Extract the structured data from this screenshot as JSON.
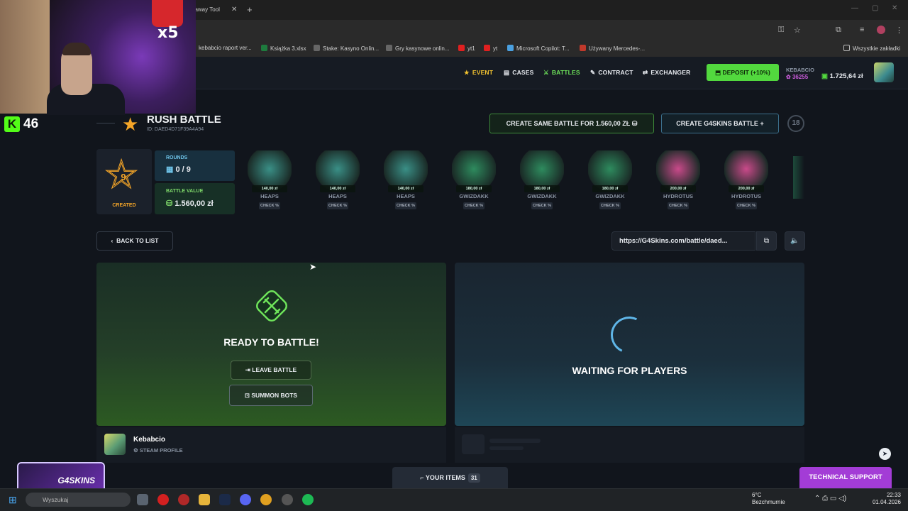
{
  "browser": {
    "tab_title": "eaway Tool",
    "bookmarks": [
      "kebabcio raport ver...",
      "Książka 3.xlsx",
      "Stake: Kasyno Onlin...",
      "Gry kasynowe onlin...",
      "yt1",
      "yt",
      "Microsoft Copilot: T...",
      "Używany Mercedes-..."
    ],
    "bookmarks_right": "Wszystkie zakładki"
  },
  "stream": {
    "kick_count": "46",
    "camera_sign": "x5"
  },
  "header": {
    "nav": [
      "EVENT",
      "CASES",
      "BATTLES",
      "CONTRACT",
      "EXCHANGER"
    ],
    "deposit_label": "DEPOSIT (+10%)",
    "username": "KEBABCIO",
    "coins": "36255",
    "balance": "1.725,64 zł"
  },
  "battle": {
    "title": "RUSH BATTLE",
    "id": "ID: DAED4D71F39A4A94",
    "create_same": "CREATE SAME BATTLE FOR 1.560,00 ZŁ",
    "create_new": "CREATE G4SKINS BATTLE",
    "age_badge": "18",
    "created_count": "9",
    "created_label": "CREATED",
    "rounds_label": "ROUNDS",
    "rounds_value": "0 / 9",
    "value_label": "BATTLE VALUE",
    "value_value": "1.560,00 zł",
    "back_label": "BACK TO LIST",
    "share_url": "https://G4Skins.com/battle/daed...",
    "ready_text": "READY TO BATTLE!",
    "leave_label": "LEAVE BATTLE",
    "summon_label": "SUMMON BOTS",
    "waiting_text": "WAITING FOR PLAYERS",
    "player_name": "Kebabcio",
    "player_link": "STEAM PROFILE"
  },
  "cases": [
    {
      "name": "HEAPS",
      "price": "140,00 zł",
      "check": "CHECK %",
      "color": "#3a8f86"
    },
    {
      "name": "HEAPS",
      "price": "140,00 zł",
      "check": "CHECK %",
      "color": "#3a8f86"
    },
    {
      "name": "HEAPS",
      "price": "140,00 zł",
      "check": "CHECK %",
      "color": "#3a8f86"
    },
    {
      "name": "GWIZDAKK",
      "price": "180,00 zł",
      "check": "CHECK %",
      "color": "#2e8b5e"
    },
    {
      "name": "GWIZDAKK",
      "price": "180,00 zł",
      "check": "CHECK %",
      "color": "#2e8b5e"
    },
    {
      "name": "GWIZDAKK",
      "price": "180,00 zł",
      "check": "CHECK %",
      "color": "#2e8b5e"
    },
    {
      "name": "HYDROTUS",
      "price": "200,00 zł",
      "check": "CHECK %",
      "color": "#c94a8a"
    },
    {
      "name": "HYDROTUS",
      "price": "200,00 zł",
      "check": "CHECK %",
      "color": "#c94a8a"
    }
  ],
  "footer": {
    "your_items": "YOUR ITEMS",
    "items_count": "31",
    "support": "TECHNICAL SUPPORT",
    "logo": "G4SKINS"
  },
  "taskbar": {
    "search": "Wyszukaj",
    "temp": "6°C",
    "weather": "Bezchmurnie",
    "time": "22:33",
    "date": "01.04.2026"
  }
}
